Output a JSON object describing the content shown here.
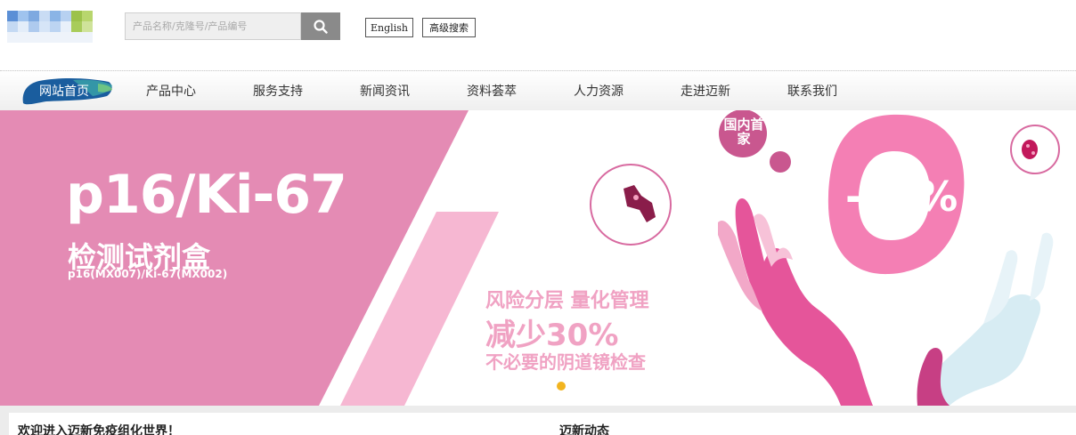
{
  "search": {
    "placeholder": "产品名称/克隆号/产品编号"
  },
  "top_links": {
    "english": "English",
    "advanced_search": "高级搜索"
  },
  "nav": {
    "items": [
      {
        "label": "网站首页",
        "active": true
      },
      {
        "label": "产品中心",
        "active": false
      },
      {
        "label": "服务支持",
        "active": false
      },
      {
        "label": "新闻资讯",
        "active": false
      },
      {
        "label": "资料荟萃",
        "active": false
      },
      {
        "label": "人力资源",
        "active": false
      },
      {
        "label": "走进迈新",
        "active": false
      },
      {
        "label": "联系我们",
        "active": false
      }
    ]
  },
  "banner": {
    "title": "p16/Ki-67",
    "subtitle": "检测试剂盒",
    "codes": "p16(MX007)/Ki-67(MX002)",
    "slogan_line1": "风险分层  量化管理",
    "slogan_line2": "减少30%",
    "slogan_line3": "不必要的阴道镜检查",
    "badge": "国内首家",
    "percent": "-30%"
  },
  "bottom": {
    "welcome": "欢迎进入迈新免疫组化世界！",
    "latest": "迈新动态"
  },
  "colors": {
    "pink_panel": "#e48bb4",
    "pink_stripe": "#f6b7d2",
    "slogan_pink": "#f0a2c3",
    "badge_pink": "#c9578f",
    "ring_pink": "#f47fb4",
    "indicator": "#f2b41f",
    "nav_brush": "#1a5d9e"
  },
  "icons": {
    "search": "search-icon",
    "logo": "logo-icon"
  }
}
